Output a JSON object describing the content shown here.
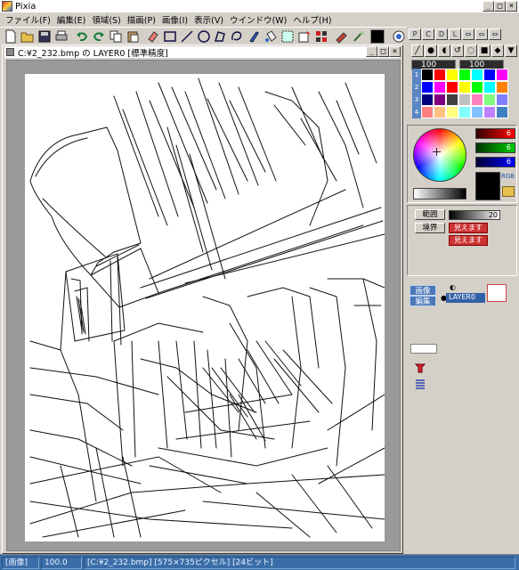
{
  "window": {
    "title": "Pixia",
    "controls": [
      "_",
      "□",
      "×"
    ]
  },
  "menubar": [
    "ファイル(F)",
    "編集(E)",
    "領域(S)",
    "描画(P)",
    "画像(I)",
    "表示(V)",
    "ウインドウ(W)",
    "ヘルプ(H)"
  ],
  "toolbar": {
    "tools": [
      "new-icon",
      "open-icon",
      "save-icon",
      "print-icon",
      "undo-icon",
      "redo-icon",
      "copy-icon",
      "paste-icon",
      "eraser-icon",
      "rect-icon",
      "line-icon",
      "circle-icon",
      "polygon-icon",
      "lasso-icon",
      "brush-icon",
      "fill-icon",
      "select-icon",
      "transform-icon",
      "grid-icon",
      "pen-icon",
      "smudge-icon"
    ],
    "current_color": "#000000"
  },
  "document": {
    "title": "C:¥2_232.bmp の LAYER0 [標準精度]",
    "controls": [
      "_",
      "□",
      "×"
    ]
  },
  "right_panel": {
    "tabs": [
      "P",
      "C",
      "D",
      "L"
    ],
    "pen_size": "100",
    "pen_density": "100",
    "palette_rows": [
      "1",
      "2",
      "3",
      "4"
    ],
    "palette_colors": [
      [
        "#000000",
        "#ff0000",
        "#ffff00",
        "#00ff00",
        "#00ffff",
        "#0000ff",
        "#ff00ff"
      ],
      [
        "#0000ff",
        "#ff00ff",
        "#ff0000",
        "#ffff00",
        "#00ff00",
        "#00ffff",
        "#ff8000"
      ],
      [
        "#000080",
        "#800080",
        "#404040",
        "#c0c0c0",
        "#ff80c0",
        "#80ff80",
        "#8080ff"
      ],
      [
        "#ff8080",
        "#ffc080",
        "#ffff80",
        "#80ffff",
        "#80c0ff",
        "#c080ff",
        "#4080c0"
      ]
    ],
    "rgb": {
      "r": "6",
      "g": "6",
      "b": "6",
      "label": "RGB"
    },
    "brush": {
      "range_label": "範囲",
      "range_value": "20",
      "boundary_label": "境界",
      "btn1": "見えます",
      "btn2": "見えます"
    },
    "layers": {
      "btn_image": "画像",
      "btn_edit": "編集",
      "layer_name": "LAYER0"
    }
  },
  "statusbar": {
    "mode": "[画像]",
    "zoom": "100.0",
    "info": "[C:¥2_232.bmp] [575×735ピクセル] [24ビット]"
  }
}
